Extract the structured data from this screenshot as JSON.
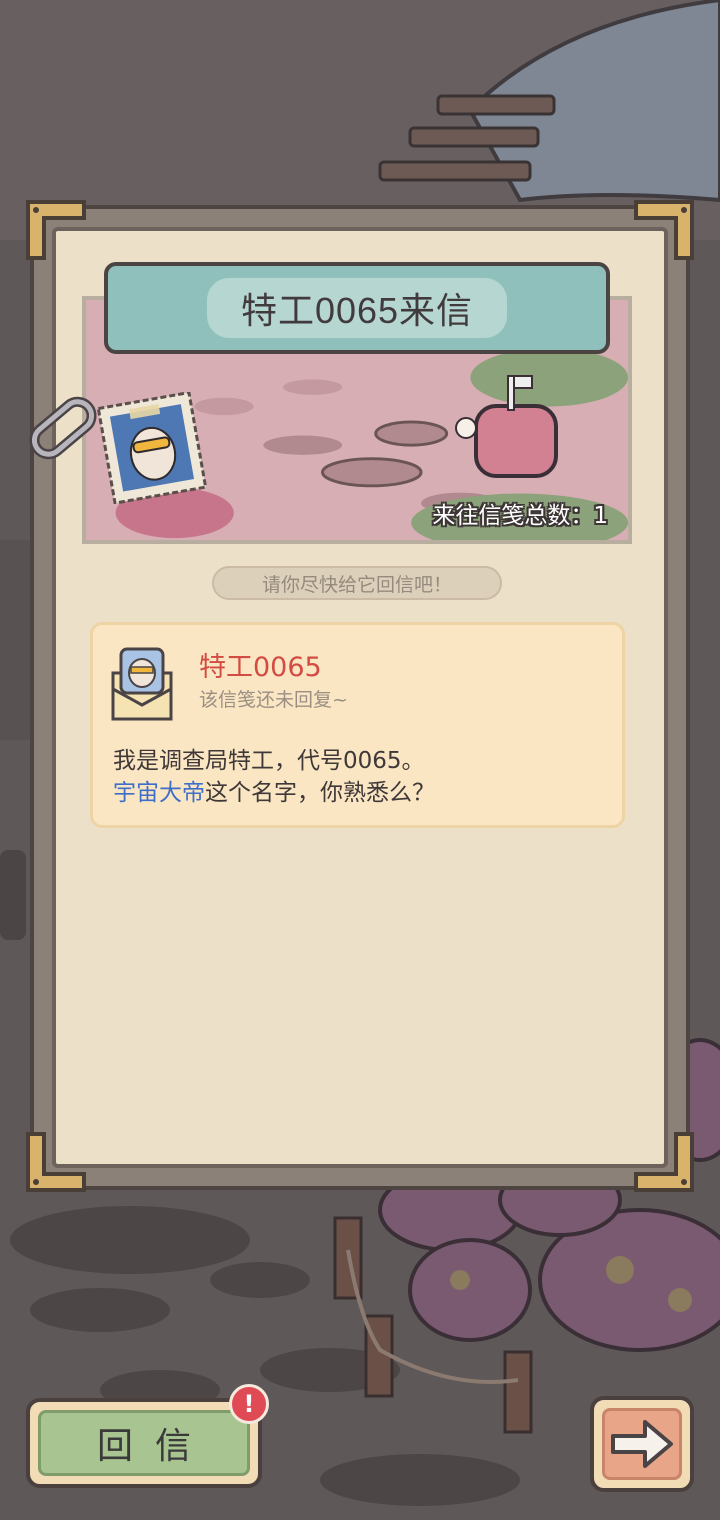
{
  "header": {
    "title": "特工0065来信"
  },
  "banner": {
    "letter_count": "来往信笺总数：1"
  },
  "hint": "请你尽快给它回信吧！",
  "letter": {
    "sender": "特工0065",
    "status": "该信笺还未回复~",
    "line1": "我是调查局特工，代号0065。",
    "line2_highlight": "宇宙大帝",
    "line2_rest": "这个名字，你熟悉么？"
  },
  "actions": {
    "reply_label": "回信",
    "alert_badge": "!"
  },
  "icons": [
    "chain-link-icon",
    "stamp-portrait-icon",
    "mailbox-icon",
    "envelope-avatar-icon",
    "arrow-right-icon"
  ],
  "colors": {
    "title_bar": "#8fc0bb",
    "sender_name": "#d24c43",
    "highlight_name": "#3d6fc8",
    "reply_button": "#a8c490",
    "badge": "#e04a55"
  }
}
